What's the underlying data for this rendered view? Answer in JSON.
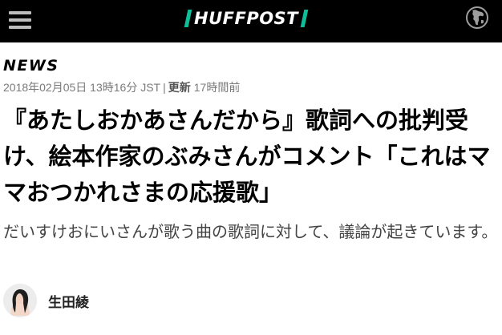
{
  "header": {
    "logo_text": "HUFFPOST",
    "accent_color": "#0dbe98",
    "background_color": "#000000",
    "menu_icon": "hamburger-menu-icon",
    "edition_icon": "globe-icon"
  },
  "article": {
    "section": "NEWS",
    "published": "2018年02月05日 13時16分 JST",
    "separator": "|",
    "updated_label": "更新",
    "updated_ago": "17時間前",
    "headline": "『あたしおかあさんだから』歌詞への批判受け、絵本作家のぶみさんがコメント「これはママおつかれさまの応援歌」",
    "subtitle": "だいすけおにいさんが歌う曲の歌詞に対して、議論が起きています。",
    "author": {
      "name": "生田綾"
    }
  }
}
